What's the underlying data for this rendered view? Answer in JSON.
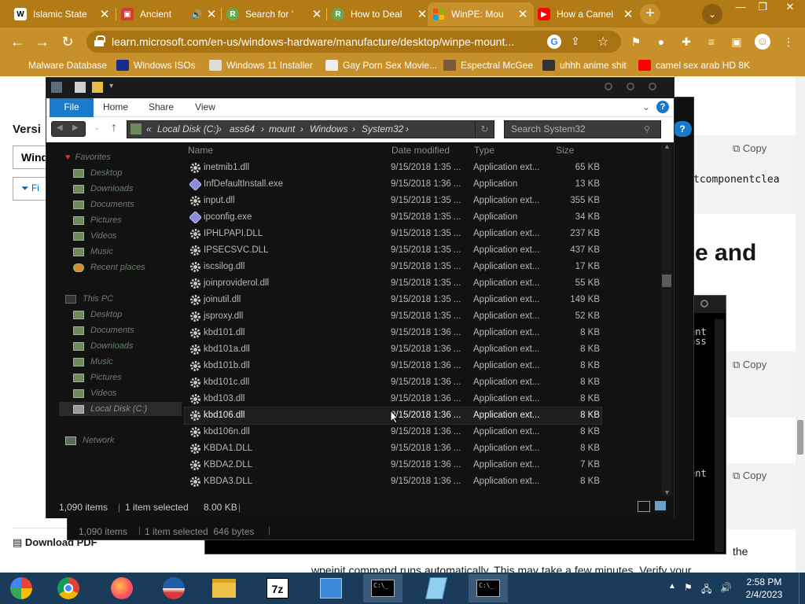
{
  "browser": {
    "tabs": [
      {
        "label": "Islamic State",
        "favicon": "W",
        "active": false
      },
      {
        "label": "Ancient",
        "favicon": "media-icon",
        "active": false,
        "audio": true
      },
      {
        "label": "Search for '",
        "favicon": "R",
        "active": false
      },
      {
        "label": "How to Deal",
        "favicon": "R",
        "active": false
      },
      {
        "label": "WinPE: Mou",
        "favicon": "ms",
        "active": true
      },
      {
        "label": "How a Camel",
        "favicon": "youtube",
        "active": false
      }
    ],
    "url": "learn.microsoft.com/en-us/windows-hardware/manufacture/desktop/winpe-mount...",
    "bookmarks": [
      "Malware Database",
      "Windows ISOs",
      "Windows 11 Installer",
      "Gay Porn Sex Movie...",
      "Espectral McGee",
      "uhhh anime shit",
      "camel sex arab HD 8K"
    ],
    "accent": "#c8902a"
  },
  "page": {
    "version_label": "Versi",
    "version_select": "Wind",
    "filter_label": "Fi",
    "copy_label": "Copy",
    "code_snippet": "tcomponentclea",
    "heading_fragment": "e and",
    "download_pdf": "Download PDF",
    "footer_text_1": "the",
    "footer_text_2": "wpeinit command runs automatically. This may take a few minutes. Verify your"
  },
  "cmd": {
    "lines_a": [
      "ent",
      "ass"
    ],
    "lines_b": [
      "ent"
    ]
  },
  "behind_explorer": {
    "status_items": "1,090 items",
    "status_selected": "1 item selected  646 bytes"
  },
  "explorer": {
    "ribbon_tabs": [
      "File",
      "Home",
      "Share",
      "View"
    ],
    "breadcrumb": [
      "Local Disk (C:)",
      "ass64",
      "mount",
      "Windows",
      "System32"
    ],
    "search_placeholder": "Search System32",
    "nav": {
      "favorites_header": "Favorites",
      "favorites": [
        "Desktop",
        "Downloads",
        "Documents",
        "Pictures",
        "Videos",
        "Music",
        "Recent places"
      ],
      "thispc_header": "This PC",
      "thispc": [
        "Desktop",
        "Documents",
        "Downloads",
        "Music",
        "Pictures",
        "Videos",
        "Local Disk (C:)"
      ],
      "network": "Network"
    },
    "columns": {
      "name": "Name",
      "date": "Date modified",
      "type": "Type",
      "size": "Size"
    },
    "files": [
      {
        "name": "inetmib1.dll",
        "date": "9/15/2018 1:35 ...",
        "type": "Application ext...",
        "size": "65 KB",
        "icon": "gear-icon"
      },
      {
        "name": "InfDefaultInstall.exe",
        "date": "9/15/2018 1:36 ...",
        "type": "Application",
        "size": "13 KB",
        "icon": "exe-icon"
      },
      {
        "name": "input.dll",
        "date": "9/15/2018 1:35 ...",
        "type": "Application ext...",
        "size": "355 KB",
        "icon": "gear-icon"
      },
      {
        "name": "ipconfig.exe",
        "date": "9/15/2018 1:35 ...",
        "type": "Application",
        "size": "34 KB",
        "icon": "exe-icon"
      },
      {
        "name": "IPHLPAPI.DLL",
        "date": "9/15/2018 1:35 ...",
        "type": "Application ext...",
        "size": "237 KB",
        "icon": "gear-icon"
      },
      {
        "name": "IPSECSVC.DLL",
        "date": "9/15/2018 1:35 ...",
        "type": "Application ext...",
        "size": "437 KB",
        "icon": "gear-icon"
      },
      {
        "name": "iscsilog.dll",
        "date": "9/15/2018 1:35 ...",
        "type": "Application ext...",
        "size": "17 KB",
        "icon": "gear-icon"
      },
      {
        "name": "joinproviderol.dll",
        "date": "9/15/2018 1:35 ...",
        "type": "Application ext...",
        "size": "55 KB",
        "icon": "gear-icon"
      },
      {
        "name": "joinutil.dll",
        "date": "9/15/2018 1:35 ...",
        "type": "Application ext...",
        "size": "149 KB",
        "icon": "gear-icon"
      },
      {
        "name": "jsproxy.dll",
        "date": "9/15/2018 1:35 ...",
        "type": "Application ext...",
        "size": "52 KB",
        "icon": "gear-icon"
      },
      {
        "name": "kbd101.dll",
        "date": "9/15/2018 1:36 ...",
        "type": "Application ext...",
        "size": "8 KB",
        "icon": "gear-icon"
      },
      {
        "name": "kbd101a.dll",
        "date": "9/15/2018 1:36 ...",
        "type": "Application ext...",
        "size": "8 KB",
        "icon": "gear-icon"
      },
      {
        "name": "kbd101b.dll",
        "date": "9/15/2018 1:36 ...",
        "type": "Application ext...",
        "size": "8 KB",
        "icon": "gear-icon"
      },
      {
        "name": "kbd101c.dll",
        "date": "9/15/2018 1:36 ...",
        "type": "Application ext...",
        "size": "8 KB",
        "icon": "gear-icon"
      },
      {
        "name": "kbd103.dll",
        "date": "9/15/2018 1:36 ...",
        "type": "Application ext...",
        "size": "8 KB",
        "icon": "gear-icon"
      },
      {
        "name": "kbd106.dll",
        "date": "9/15/2018 1:36 ...",
        "type": "Application ext...",
        "size": "8 KB",
        "icon": "gear-icon",
        "hot": true
      },
      {
        "name": "kbd106n.dll",
        "date": "9/15/2018 1:36 ...",
        "type": "Application ext...",
        "size": "8 KB",
        "icon": "gear-icon"
      },
      {
        "name": "KBDA1.DLL",
        "date": "9/15/2018 1:36 ...",
        "type": "Application ext...",
        "size": "8 KB",
        "icon": "gear-icon"
      },
      {
        "name": "KBDA2.DLL",
        "date": "9/15/2018 1:36 ...",
        "type": "Application ext...",
        "size": "7 KB",
        "icon": "gear-icon"
      },
      {
        "name": "KBDA3.DLL",
        "date": "9/15/2018 1:36 ...",
        "type": "Application ext...",
        "size": "8 KB",
        "icon": "gear-icon"
      }
    ],
    "status_items": "1,090 items",
    "status_selected": "1 item selected",
    "status_size": "8.00 KB"
  },
  "taskbar": {
    "apps": [
      "start-icon",
      "chrome-icon",
      "firefox-icon",
      "obama-icon",
      "file-explorer-icon",
      "7zip-icon",
      "control-panel-icon",
      "cmd-icon",
      "notepad-icon",
      "cmd-icon"
    ],
    "time": "2:58 PM",
    "date": "2/4/2023"
  }
}
